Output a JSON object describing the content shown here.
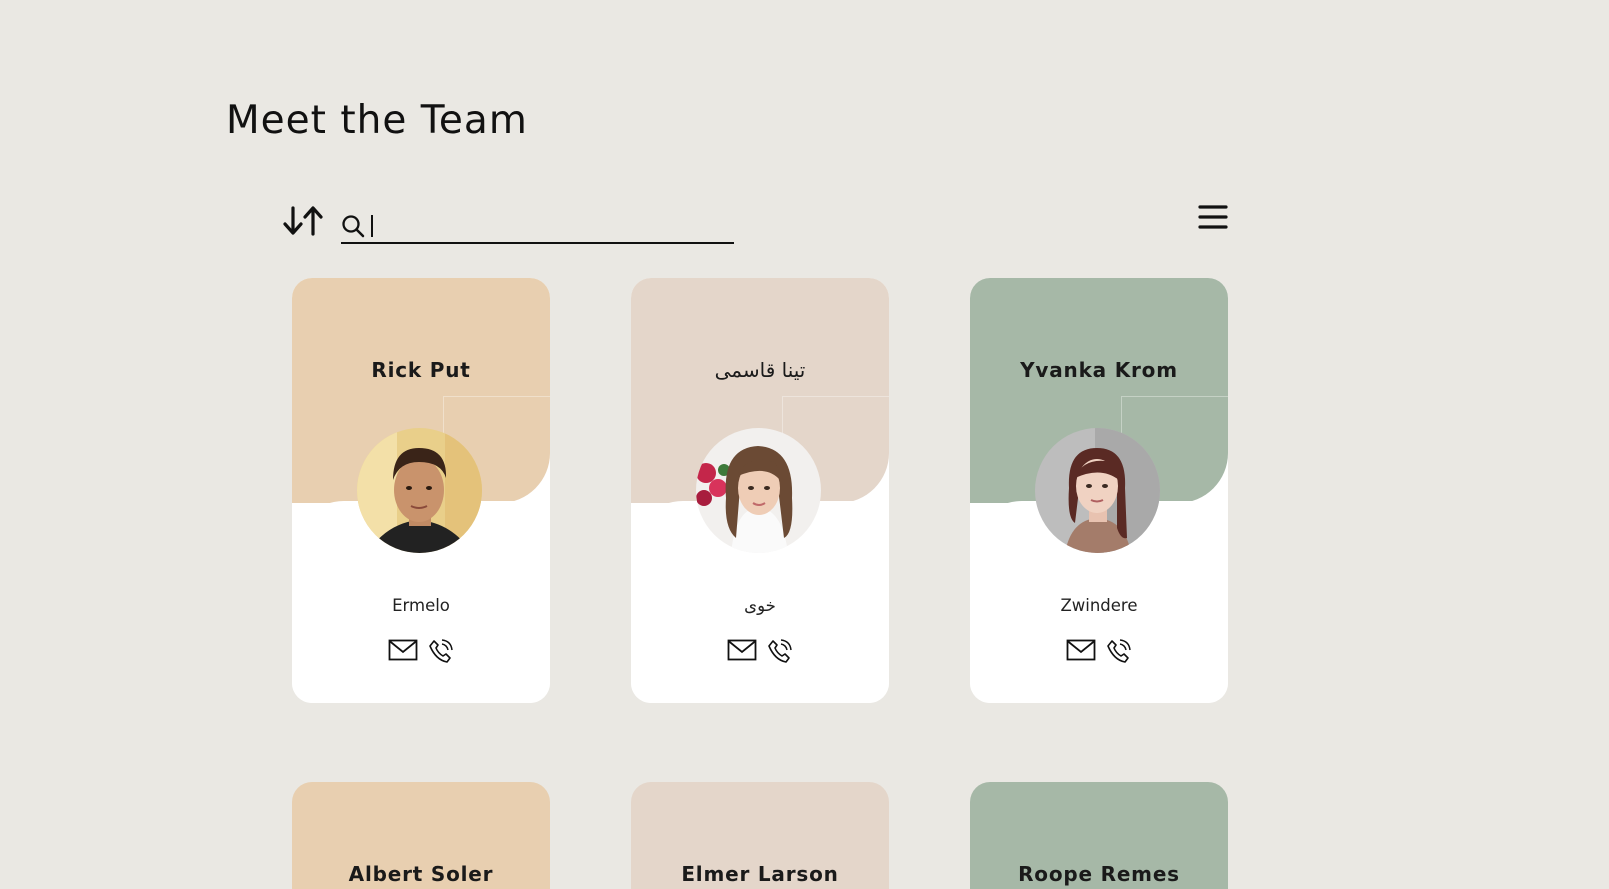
{
  "page": {
    "title": "Meet the Team"
  },
  "toolbar": {
    "sort_icon": "sort-arrows-icon",
    "search_icon": "search-icon",
    "search_value": "",
    "menu_icon": "hamburger-menu-icon"
  },
  "colors": {
    "background": "#eae8e3",
    "tan": "#e8cfb0",
    "rose": "#e4d6ca",
    "sage": "#a6b8a7"
  },
  "team": [
    {
      "name": "Rick Put",
      "city": "Ermelo",
      "color": "#e8cfb0",
      "avatar": "avatar-man-dark-hair"
    },
    {
      "name": "تینا قاسمی",
      "city": "خوی",
      "color": "#e4d6ca",
      "avatar": "avatar-woman-long-hair-flowers"
    },
    {
      "name": "Yvanka Krom",
      "city": "Zwindere",
      "color": "#a6b8a7",
      "avatar": "avatar-woman-red-hair"
    },
    {
      "name": "Albert Soler",
      "color": "#e8cfb0"
    },
    {
      "name": "Elmer Larson",
      "color": "#e4d6ca"
    },
    {
      "name": "Roope Remes",
      "color": "#a6b8a7"
    }
  ]
}
